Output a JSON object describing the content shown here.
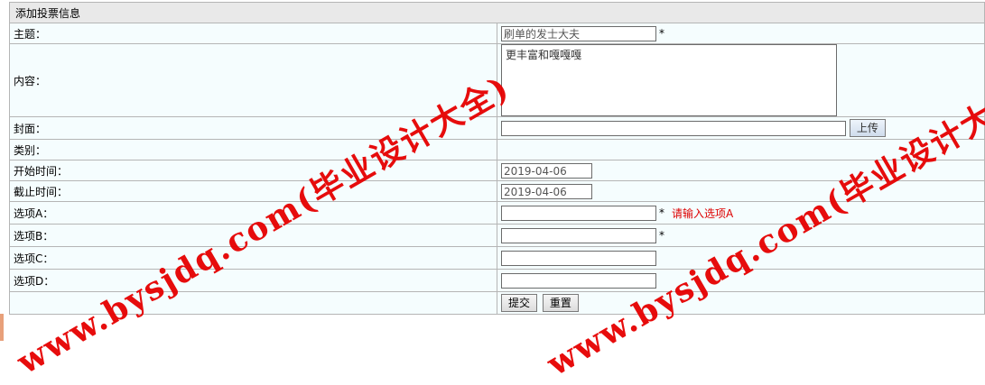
{
  "header": {
    "title": "添加投票信息"
  },
  "fields": {
    "subject": {
      "label": "主题：",
      "value": "刷单的发士大夫",
      "required": "*"
    },
    "content": {
      "label": "内容：",
      "value": "更丰富和嘎嘎嘎"
    },
    "cover": {
      "label": "封面：",
      "value": "",
      "upload_label": "上传"
    },
    "category": {
      "label": "类别："
    },
    "start_time": {
      "label": "开始时间：",
      "value": "2019-04-06"
    },
    "end_time": {
      "label": "截止时间：",
      "value": "2019-04-06"
    },
    "option_a": {
      "label": "选项A：",
      "value": "",
      "required": "*",
      "error": "请输入选项A"
    },
    "option_b": {
      "label": "选项B：",
      "value": "",
      "required": "*"
    },
    "option_c": {
      "label": "选项C：",
      "value": ""
    },
    "option_d": {
      "label": "选项D：",
      "value": ""
    }
  },
  "actions": {
    "submit_label": "提交",
    "reset_label": "重置"
  },
  "watermark": {
    "text": "www.bysjdq.com(毕业设计大全)",
    "color": "#e60000"
  }
}
